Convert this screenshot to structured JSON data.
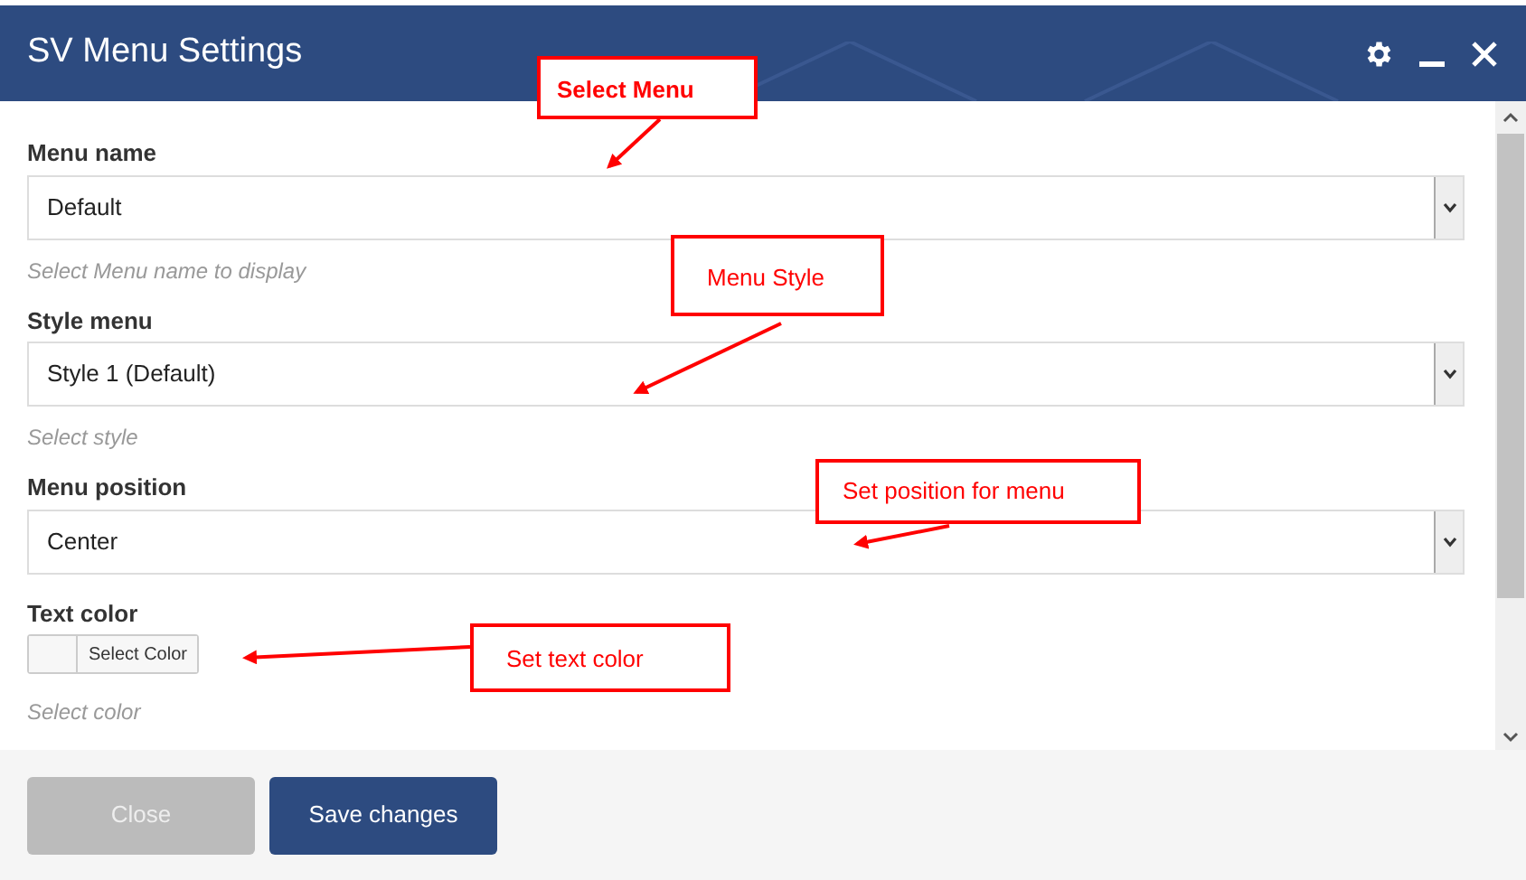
{
  "window": {
    "title": "SV Menu Settings"
  },
  "fields": [
    {
      "kind": "select",
      "label": "Menu name",
      "value": "Default",
      "hint": "Select Menu name to display"
    },
    {
      "kind": "select",
      "label": "Style menu",
      "value": "Style 1 (Default)",
      "hint": "Select style"
    },
    {
      "kind": "select",
      "label": "Menu position",
      "value": "Center"
    },
    {
      "kind": "color",
      "label": "Text color",
      "button_label": "Select Color",
      "hint": "Select color"
    }
  ],
  "buttons": [
    {
      "kind": "secondary",
      "label": "Close"
    },
    {
      "kind": "primary",
      "label": "Save changes"
    }
  ],
  "annotations": [
    {
      "text": "Select Menu"
    },
    {
      "text": "Menu Style"
    },
    {
      "text": "Set position for menu"
    },
    {
      "text": "Set text color"
    }
  ]
}
